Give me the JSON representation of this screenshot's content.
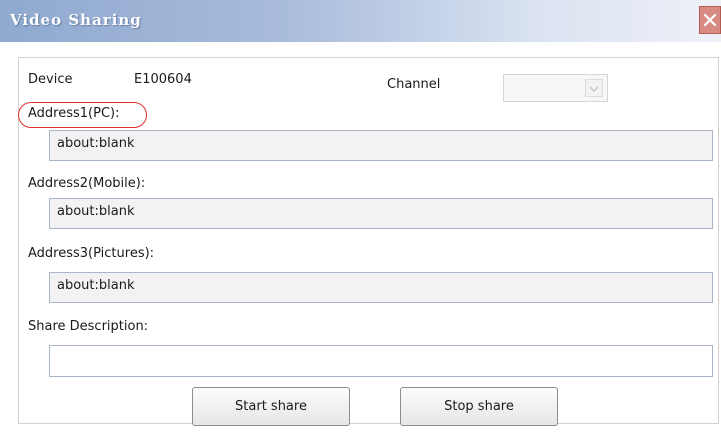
{
  "window": {
    "title": "Video Sharing"
  },
  "device": {
    "label": "Device",
    "value": "E100604"
  },
  "channel": {
    "label": "Channel",
    "value": ""
  },
  "address1": {
    "label": "Address1(PC):",
    "value": "about:blank"
  },
  "address2": {
    "label": "Address2(Mobile):",
    "value": "about:blank"
  },
  "address3": {
    "label": "Address3(Pictures):",
    "value": "about:blank"
  },
  "share_description": {
    "label": "Share Description:",
    "value": ""
  },
  "buttons": {
    "start": "Start share",
    "stop": "Stop share"
  },
  "colors": {
    "title_gradient_start": "#8fa9cf",
    "close_button": "#d98b82",
    "highlight_circle": "#e03030"
  },
  "icons": {
    "close": "close-icon",
    "dropdown": "chevron-down-icon"
  }
}
